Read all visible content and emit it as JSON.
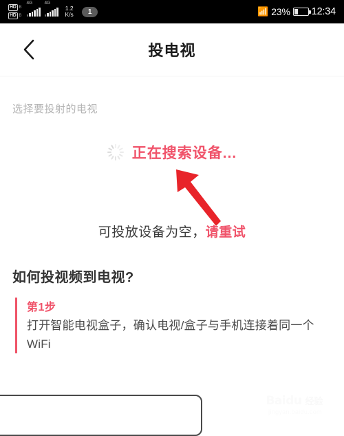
{
  "statusbar": {
    "hd_badge_1": "HD",
    "hd_sub_1": "B",
    "hd_badge_2": "HD",
    "hd_sub_2": "B",
    "network_1": "4G",
    "network_2": "4G",
    "speed_value": "1.2",
    "speed_unit": "K/s",
    "notification_count": "1",
    "bluetooth_icon": "bluetooth-icon",
    "battery_percent": "23%",
    "battery_icon": "battery-icon",
    "clock": "12:34"
  },
  "header": {
    "back_icon": "chevron-left-icon",
    "title": "投电视"
  },
  "main": {
    "subtitle": "选择要投射的电视",
    "searching_text": "正在搜索设备...",
    "spinner_icon": "loading-spinner-icon",
    "empty_prefix": "可投放设备为空，",
    "empty_retry": "请重试",
    "howto_title": "如何投视频到电视?",
    "steps": [
      {
        "label": "第1步",
        "desc": "打开智能电视盒子，确认电视/盒子与手机连接着同一个WiFi"
      }
    ]
  },
  "annotation": {
    "arrow_icon": "red-arrow-icon",
    "arrow_color": "#e8242a"
  },
  "watermark": {
    "brand": "Baidu",
    "cn_label": "经验",
    "url": "jingyan.baidu.com"
  },
  "colors": {
    "accent_red": "#f0536a",
    "status_bg": "#000000",
    "page_bg": "#ffffff"
  }
}
